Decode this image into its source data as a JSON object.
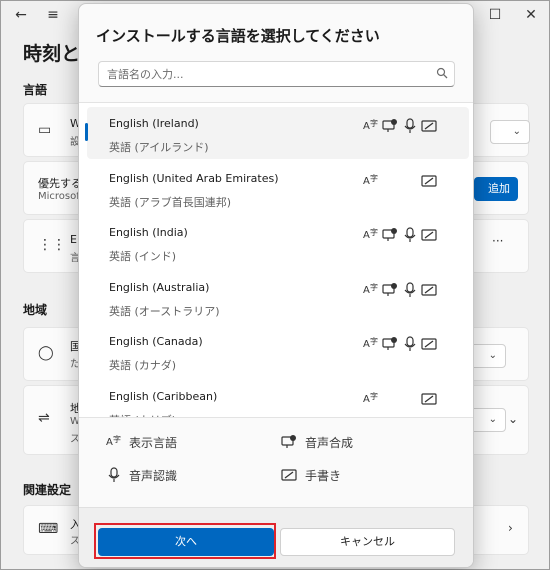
{
  "background": {
    "title": "時刻と",
    "sections": {
      "language": "言語",
      "region": "地域",
      "related": "関連設定"
    },
    "cards": {
      "display_language_short": "W",
      "display_language_sub": "設",
      "preferred_label": "優先する",
      "preferred_sub": "Microsoft",
      "add_button_fragment": "追加",
      "lang_entry_short": "E",
      "lang_entry_sub": "言",
      "country_short": "国",
      "country_sub": "た",
      "regional_format_short": "地",
      "regional_format_sub_1": "W",
      "regional_format_sub_2": "ス",
      "keyboard_short": "入",
      "keyboard_sub": "ス"
    }
  },
  "dialog": {
    "title": "インストールする言語を選択してください",
    "search": {
      "placeholder": "言語名の入力..."
    },
    "languages": [
      {
        "name": "English (Ireland)",
        "sub": "英語 (アイルランド)",
        "selected": true,
        "features": [
          "display-language-icon",
          "text-to-speech-icon",
          "speech-recognition-icon",
          "handwriting-icon"
        ]
      },
      {
        "name": "English (United Arab Emirates)",
        "sub": "英語 (アラブ首長国連邦)",
        "selected": false,
        "features": [
          "display-language-icon",
          "handwriting-icon"
        ]
      },
      {
        "name": "English (India)",
        "sub": "英語 (インド)",
        "selected": false,
        "features": [
          "display-language-icon",
          "text-to-speech-icon",
          "speech-recognition-icon",
          "handwriting-icon"
        ]
      },
      {
        "name": "English (Australia)",
        "sub": "英語 (オーストラリア)",
        "selected": false,
        "features": [
          "display-language-icon",
          "text-to-speech-icon",
          "speech-recognition-icon",
          "handwriting-icon"
        ]
      },
      {
        "name": "English (Canada)",
        "sub": "英語 (カナダ)",
        "selected": false,
        "features": [
          "display-language-icon",
          "text-to-speech-icon",
          "speech-recognition-icon",
          "handwriting-icon"
        ]
      },
      {
        "name": "English (Caribbean)",
        "sub": "英語 (カリブ)",
        "selected": false,
        "features": [
          "display-language-icon",
          "handwriting-icon"
        ]
      }
    ],
    "legend": {
      "display_language": "表示言語",
      "text_to_speech": "音声合成",
      "speech_recognition": "音声認識",
      "handwriting": "手書き"
    },
    "buttons": {
      "next": "次へ",
      "cancel": "キャンセル"
    },
    "colors": {
      "accent": "#0067c0",
      "highlight_outline": "#e0242b"
    }
  }
}
